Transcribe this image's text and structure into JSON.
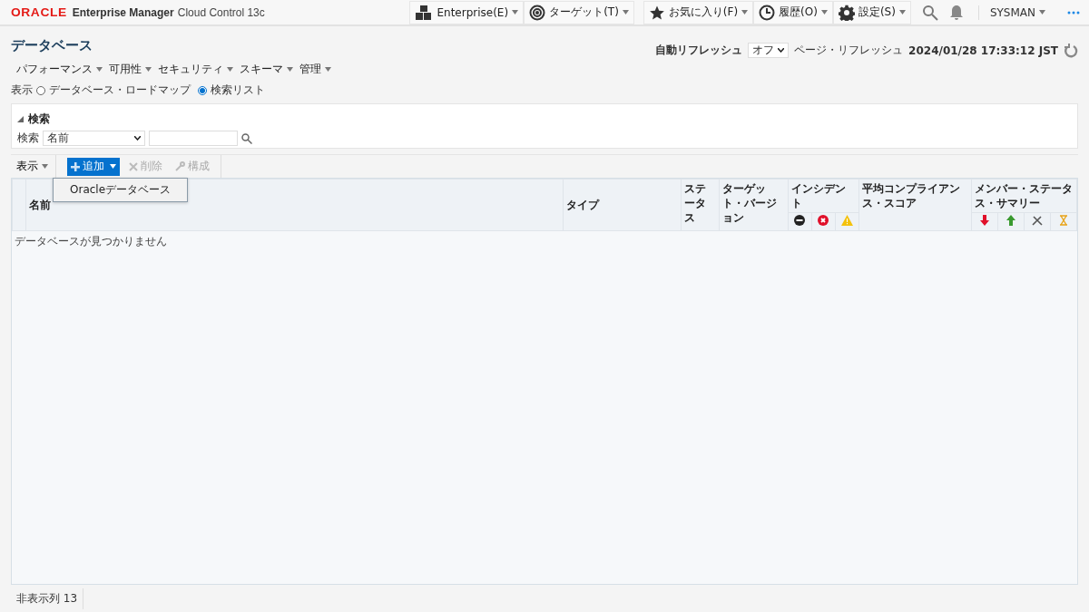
{
  "header": {
    "brand": "ORACLE",
    "product": "Enterprise Manager",
    "edition": "Cloud Control 13c",
    "menus": [
      {
        "label": "Enterprise(E)",
        "kind": "enterprise"
      },
      {
        "label": "ターゲット(T)",
        "kind": "target"
      },
      {
        "label": "お気に入り(F)",
        "kind": "favorites"
      },
      {
        "label": "履歴(O)",
        "kind": "history"
      },
      {
        "label": "設定(S)",
        "kind": "settings"
      }
    ],
    "user": "SYSMAN"
  },
  "page": {
    "title": "データベース",
    "auto_refresh_label": "自動リフレッシュ",
    "auto_refresh_value": "オフ",
    "refresh_label": "ページ・リフレッシュ",
    "refresh_time": "2024/01/28 17:33:12 JST"
  },
  "nav_menus": [
    "パフォーマンス",
    "可用性",
    "セキュリティ",
    "スキーマ",
    "管理"
  ],
  "view": {
    "label": "表示",
    "options": [
      {
        "label": "データベース・ロードマップ",
        "selected": false
      },
      {
        "label": "検索リスト",
        "selected": true
      }
    ]
  },
  "search": {
    "title": "検索",
    "expanded": true,
    "label": "検索",
    "field": "名前"
  },
  "toolbar": {
    "view_label": "表示",
    "buttons": [
      {
        "label": "追加",
        "kind": "add",
        "disabled": false
      },
      {
        "label": "削除",
        "kind": "delete",
        "disabled": true
      },
      {
        "label": "構成",
        "kind": "configure",
        "disabled": true
      }
    ]
  },
  "dropdown": [
    "Oracleデータベース"
  ],
  "table": {
    "columns": [
      {
        "label": "名前",
        "kind": "text"
      },
      {
        "label": "タイプ",
        "kind": "text"
      },
      {
        "label": "ステータス",
        "kind": "text"
      },
      {
        "label": "ターゲット・バージョン",
        "kind": "text"
      },
      {
        "label": "インシデント",
        "kind": "incident"
      },
      {
        "label": "平均コンプライアンス・スコア",
        "kind": "text"
      },
      {
        "label": "メンバー・ステータス・サマリー",
        "kind": "member"
      }
    ],
    "empty_message": "データベースが見つかりません"
  },
  "status_bar": {
    "label": "非表示列",
    "count": "13"
  }
}
